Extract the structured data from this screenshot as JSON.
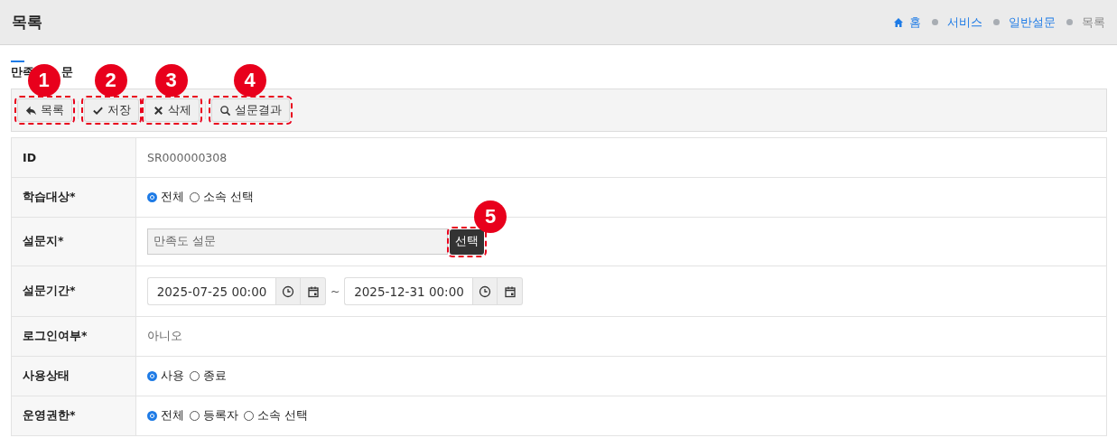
{
  "page_title": "목록",
  "breadcrumb": [
    {
      "label": "홈",
      "home": true,
      "current": false
    },
    {
      "label": "서비스",
      "home": false,
      "current": false
    },
    {
      "label": "일반설문",
      "home": false,
      "current": false
    },
    {
      "label": "목록",
      "home": false,
      "current": true
    }
  ],
  "section_title_parts": [
    "만족",
    "문"
  ],
  "toolbar": [
    {
      "label": "목록",
      "marker": "1"
    },
    {
      "label": "저장",
      "marker": "2"
    },
    {
      "label": "삭제",
      "marker": "3"
    },
    {
      "label": "설문결과",
      "marker": "4"
    }
  ],
  "form": [
    {
      "kind": "text",
      "label": "ID",
      "value": "SR000000308"
    },
    {
      "kind": "radio",
      "label": "학습대상*",
      "options": [
        {
          "label": "전체",
          "selected": true
        },
        {
          "label": "소속 선택",
          "selected": false
        }
      ]
    },
    {
      "kind": "picker",
      "label": "설문지*",
      "value": "만족도 설문",
      "button": "선택",
      "marker": "5"
    },
    {
      "kind": "daterange",
      "label": "설문기간*",
      "start": "2025-07-25 00:00",
      "separator": "~",
      "end": "2025-12-31 00:00"
    },
    {
      "kind": "text",
      "label": "로그인여부*",
      "value": "아니오"
    },
    {
      "kind": "radio",
      "label": "사용상태",
      "options": [
        {
          "label": "사용",
          "selected": true
        },
        {
          "label": "종료",
          "selected": false
        }
      ]
    },
    {
      "kind": "radio",
      "label": "운영권한*",
      "options": [
        {
          "label": "전체",
          "selected": true
        },
        {
          "label": "등록자",
          "selected": false
        },
        {
          "label": "소속 선택",
          "selected": false
        }
      ]
    }
  ]
}
